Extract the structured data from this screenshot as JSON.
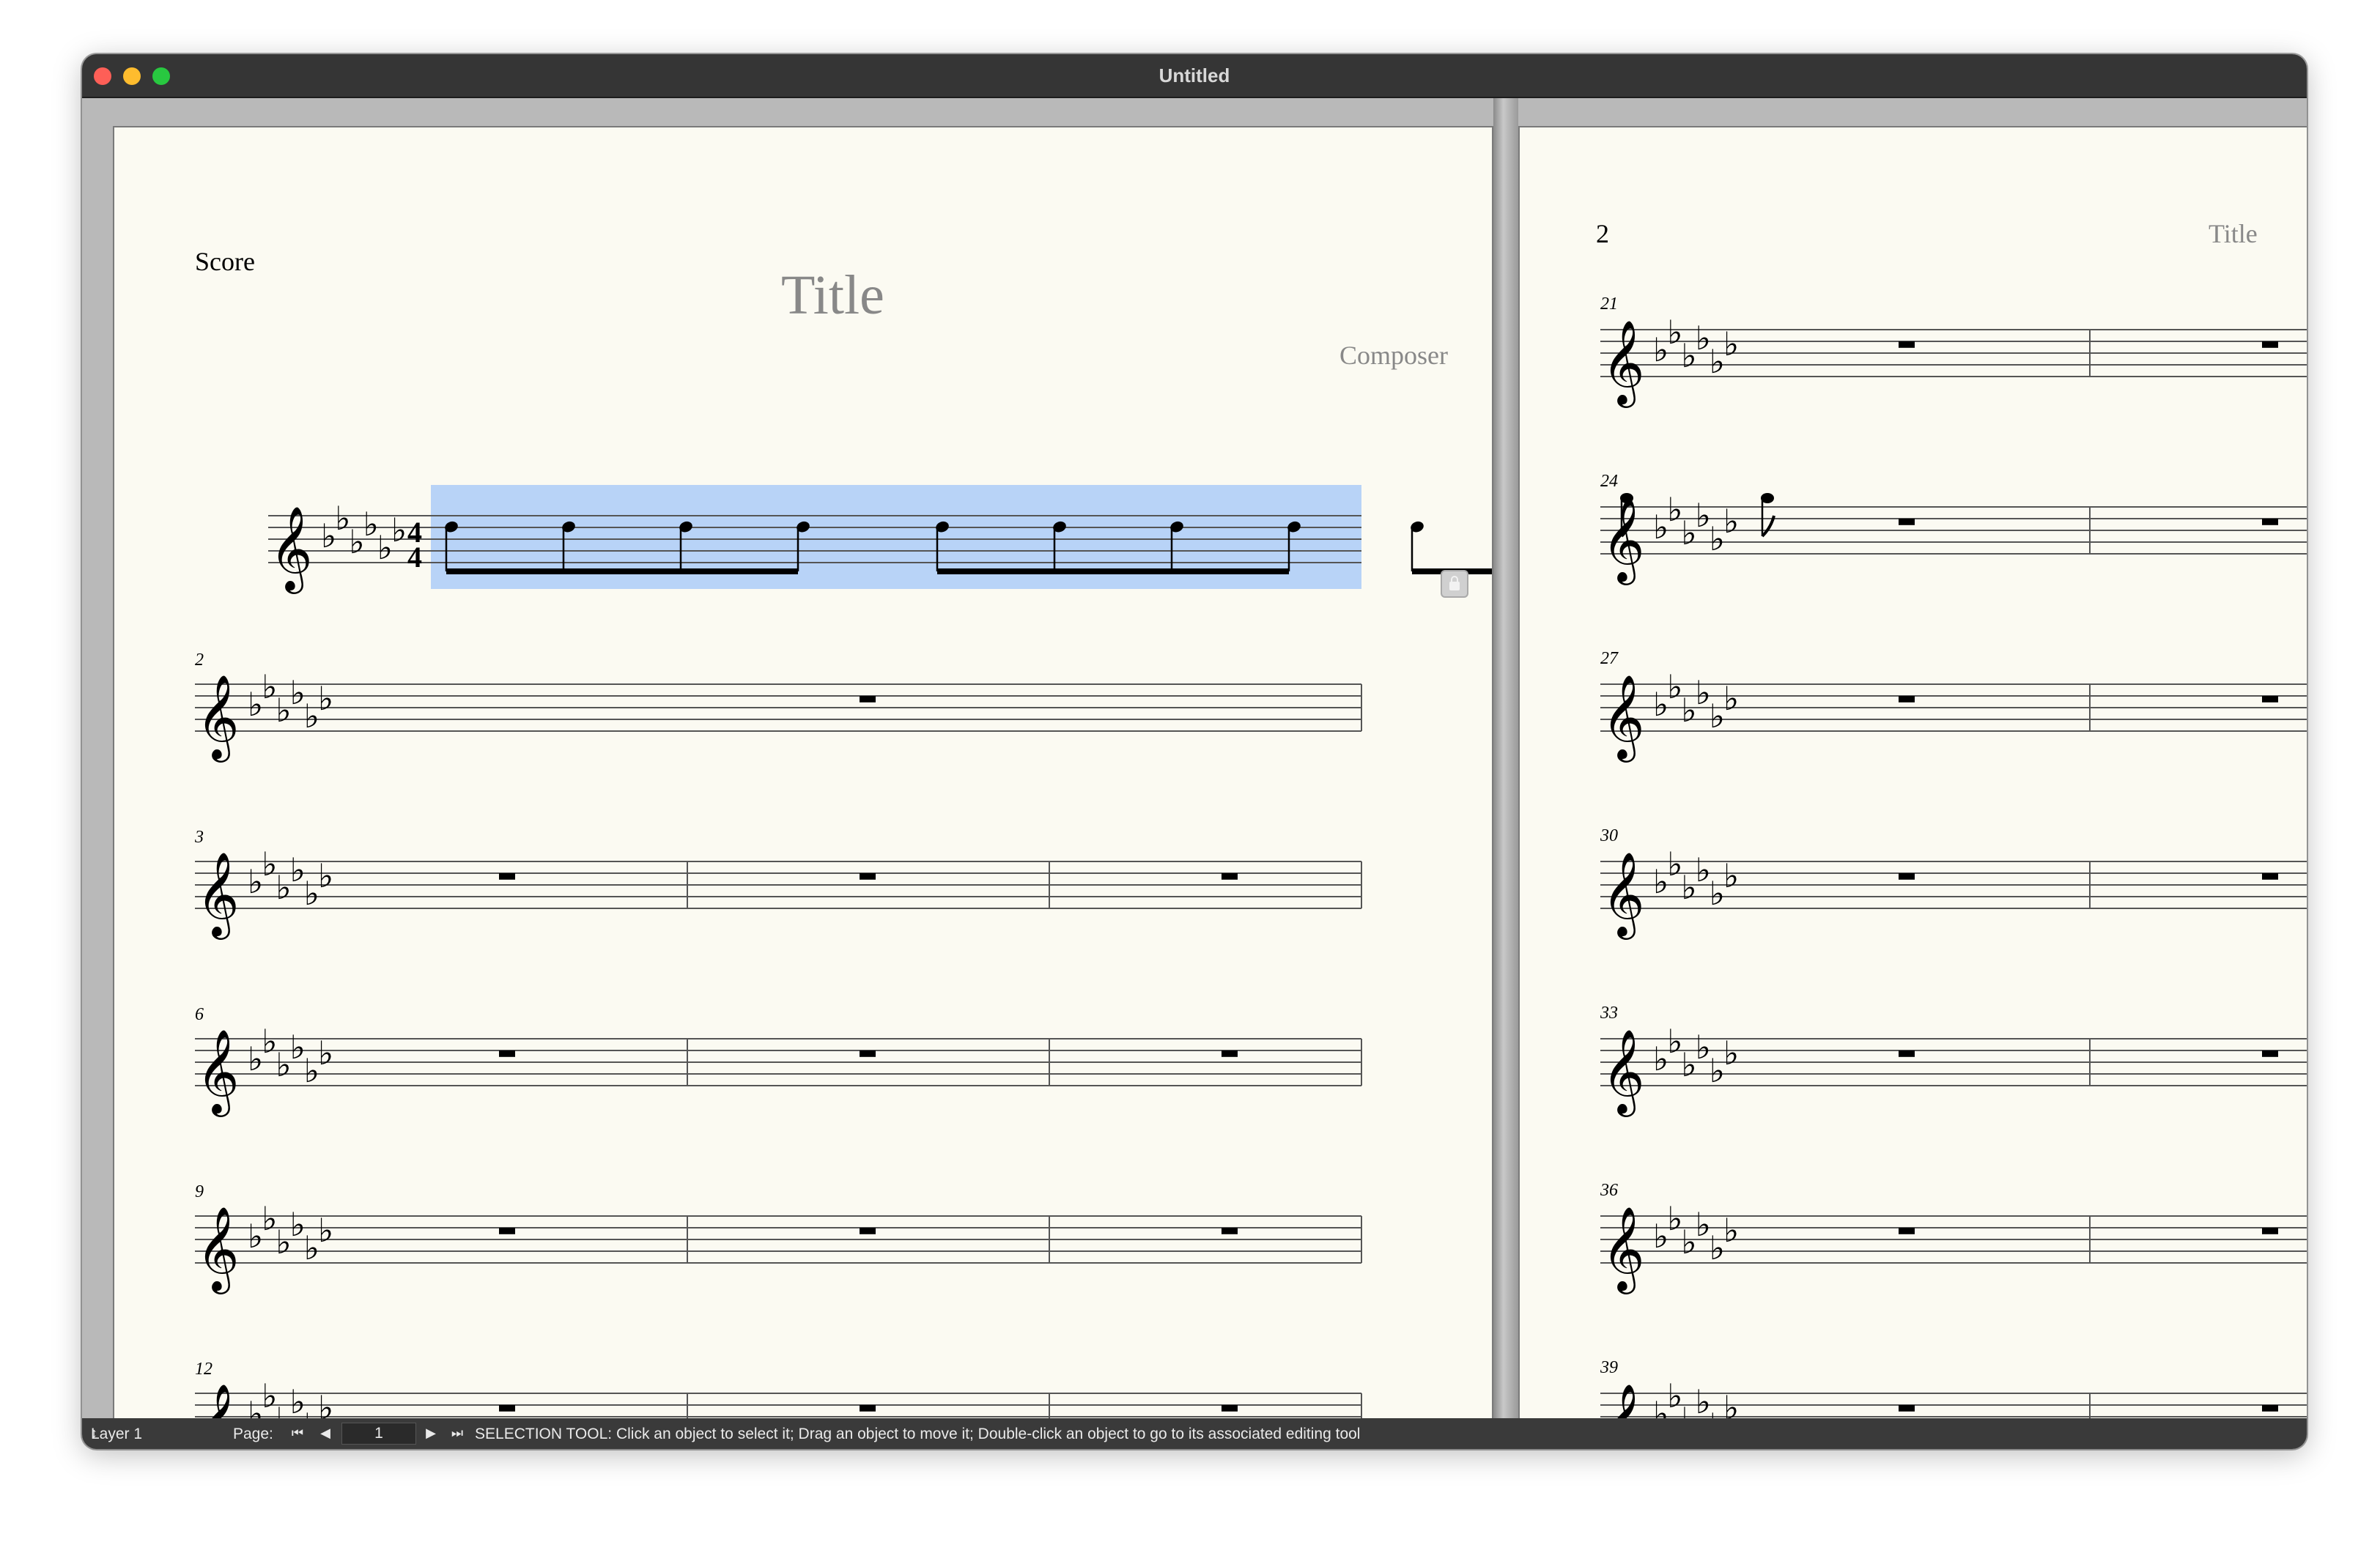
{
  "window": {
    "title": "Untitled"
  },
  "page1": {
    "label": "Score",
    "title": "Title",
    "composer": "Composer"
  },
  "page2": {
    "page_number": "2",
    "running_title": "Title"
  },
  "page1_measure_numbers": [
    "2",
    "3",
    "6",
    "9",
    "12"
  ],
  "page2_measure_numbers": [
    "21",
    "24",
    "27",
    "30",
    "33",
    "36",
    "39"
  ],
  "score": {
    "key_signature_flats": 6,
    "time_signature": {
      "top": "4",
      "bottom": "4"
    },
    "selection_color": "#b8d3f7"
  },
  "status": {
    "layer": "Layer 1",
    "page_label": "Page:",
    "page_value": "1",
    "hint": "SELECTION TOOL: Click an object to select it; Drag an object to move it; Double-click an object to go to its associated editing tool"
  },
  "icons": {
    "first": "first-page-icon",
    "prev": "previous-page-icon",
    "next": "next-page-icon",
    "last": "last-page-icon",
    "lock": "lock-icon"
  }
}
